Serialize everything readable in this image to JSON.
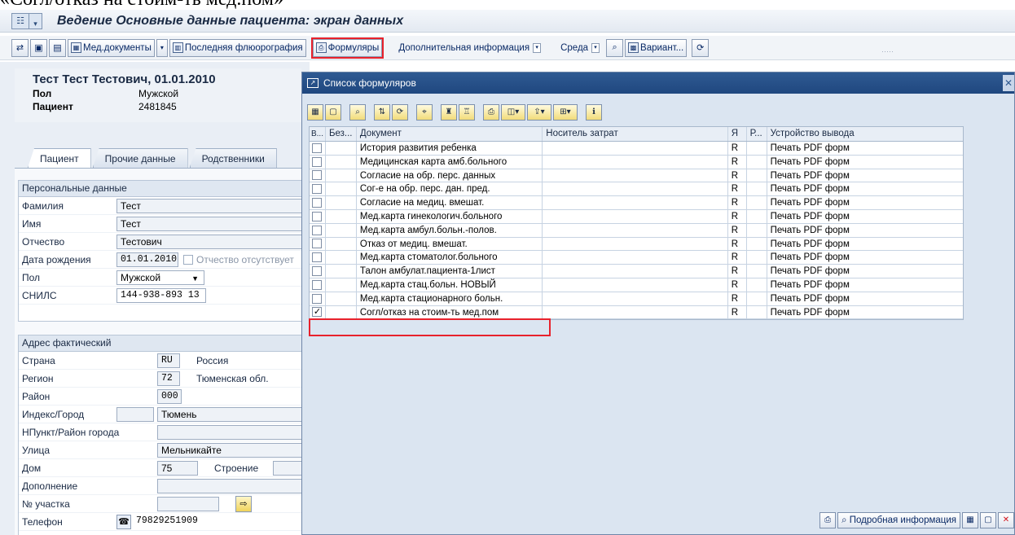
{
  "caption": "«Согл/отказ на стоим-ть мед.пом»",
  "window": {
    "title": "Ведение Основные данные пациента: экран данных"
  },
  "toolbar": {
    "med_docs": "Мед.документы",
    "last_fluoro": "Последняя флюорография",
    "forms": "Формуляры",
    "extra_info": "Дополнительная информация",
    "env": "Среда",
    "variant": "Вариант..."
  },
  "patient": {
    "name": "Тест Тест Тестович, 01.01.2010",
    "sex_label": "Пол",
    "sex_value": "Мужской",
    "patient_label": "Пациент",
    "patient_value": "2481845"
  },
  "tabs": [
    "Пациент",
    "Прочие данные",
    "Родственники"
  ],
  "personal": {
    "title": "Персональные данные",
    "surname_label": "Фамилия",
    "surname": "Тест",
    "name_label": "Имя",
    "name": "Тест",
    "patronymic_label": "Отчество",
    "patronymic": "Тестович",
    "dob_label": "Дата рождения",
    "dob": "01.01.2010",
    "no_patronymic_label": "Отчество отсутствует",
    "sex_label": "Пол",
    "sex": "Мужской",
    "snils_label": "СНИЛС",
    "snils": "144-938-893 13"
  },
  "address": {
    "title": "Адрес фактический",
    "country_label": "Страна",
    "country_code": "RU",
    "country_name": "Россия",
    "region_label": "Регион",
    "region_code": "72",
    "region_name": "Тюменская обл.",
    "district_label": "Район",
    "district_code": "000",
    "city_label": "Индекс/Город",
    "city": "Тюмень",
    "locality_label": "НПункт/Район города",
    "street_label": "Улица",
    "street": "Мельникайте",
    "house_label": "Дом",
    "house": "75",
    "building_label": "Строение",
    "addition_label": "Дополнение",
    "district_no_label": "№ участка",
    "phone_label": "Телефон",
    "phone": "79829251909"
  },
  "dialog": {
    "title": "Список формуляров",
    "columns": [
      "В...",
      "Без...",
      "Документ",
      "Носитель затрат",
      "Я",
      "Р...",
      "Устройство вывода"
    ],
    "rows": [
      {
        "doc": "История развития ребенка",
        "lang": "R",
        "device": "Печать PDF форм",
        "checked": false
      },
      {
        "doc": "Медицинская карта амб.больного",
        "lang": "R",
        "device": "Печать PDF форм",
        "checked": false
      },
      {
        "doc": "Согласие на обр. перс. данных",
        "lang": "R",
        "device": "Печать PDF форм",
        "checked": false
      },
      {
        "doc": "Сог-е на обр. перс. дан. пред.",
        "lang": "R",
        "device": "Печать PDF форм",
        "checked": false
      },
      {
        "doc": "Согласие на медиц. вмешат.",
        "lang": "R",
        "device": "Печать PDF форм",
        "checked": false
      },
      {
        "doc": "Мед.карта гинекологич.больного",
        "lang": "R",
        "device": "Печать PDF форм",
        "checked": false
      },
      {
        "doc": "Мед.карта амбул.больн.-полов.",
        "lang": "R",
        "device": "Печать PDF форм",
        "checked": false
      },
      {
        "doc": "Отказ от медиц. вмешат.",
        "lang": "R",
        "device": "Печать PDF форм",
        "checked": false
      },
      {
        "doc": "Мед.карта стоматолог.больного",
        "lang": "R",
        "device": "Печать PDF форм",
        "checked": false
      },
      {
        "doc": "Талон амбулат.пациента-1лист",
        "lang": "R",
        "device": "Печать PDF форм",
        "checked": false
      },
      {
        "doc": "Мед.карта стац.больн. НОВЫЙ",
        "lang": "R",
        "device": "Печать PDF форм",
        "checked": false
      },
      {
        "doc": "Мед.карта стационарного больн.",
        "lang": "R",
        "device": "Печать PDF форм",
        "checked": false
      },
      {
        "doc": "Согл/отказ на стоим-ть мед.пом",
        "lang": "R",
        "device": "Печать PDF форм",
        "checked": true
      }
    ],
    "detail_button": "Подробная информация"
  },
  "colors": {
    "highlight": "#e8222c",
    "dialog_title_bg": "#1f477f",
    "panel_bg": "#e9eef5"
  }
}
